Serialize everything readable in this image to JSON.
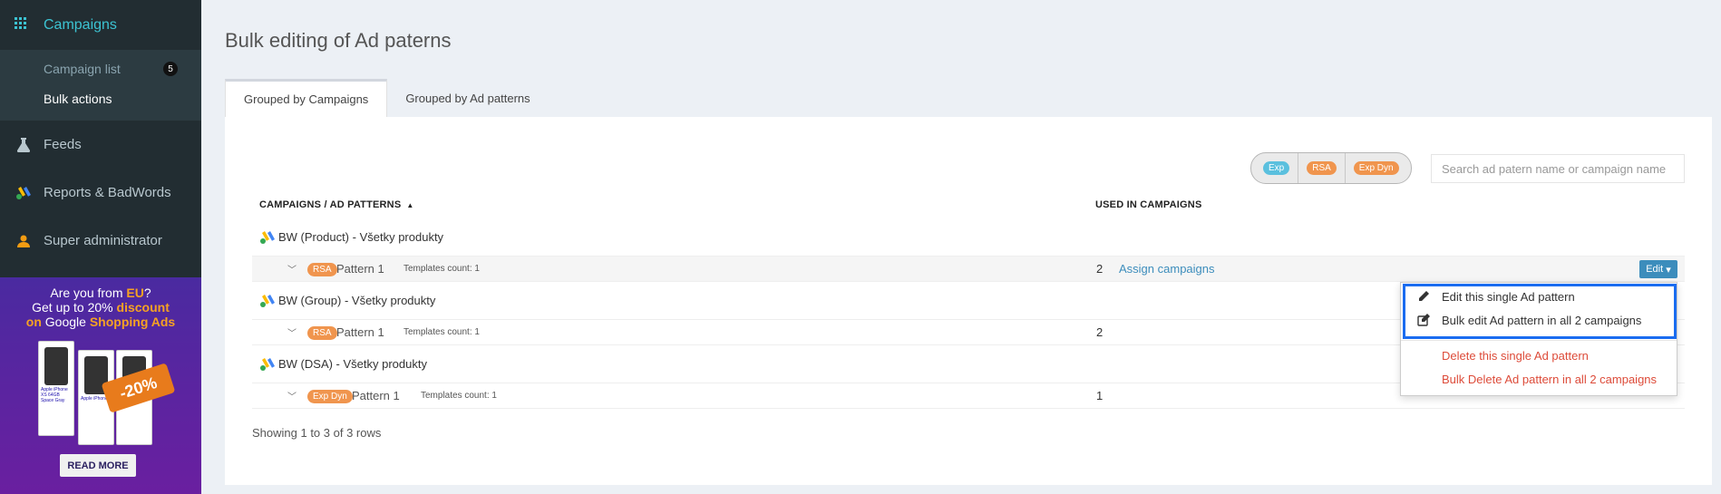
{
  "sidebar": {
    "section_title": "Campaigns",
    "sub_items": [
      {
        "label": "Campaign list",
        "badge": "5"
      },
      {
        "label": "Bulk actions"
      }
    ],
    "items": [
      {
        "label": "Feeds",
        "icon": "flask-icon"
      },
      {
        "label": "Reports & BadWords",
        "icon": "google-ads-icon"
      },
      {
        "label": "Super administrator",
        "icon": "user-icon"
      }
    ]
  },
  "promo": {
    "line1_prefix": "Are you from ",
    "line1_highlight": "EU",
    "line1_suffix": "?",
    "line2_prefix": "Get up to 20% ",
    "line2_highlight": "discount",
    "line3_prefix": "on",
    "line3_middle": " Google ",
    "line3_highlight": "Shopping Ads",
    "stamp": "-20%",
    "button": "READ MORE"
  },
  "page": {
    "title": "Bulk editing of Ad paterns",
    "tabs": [
      "Grouped by Campaigns",
      "Grouped by Ad patterns"
    ]
  },
  "filters": [
    {
      "label": "Exp",
      "color": "#5bc0de"
    },
    {
      "label": "RSA",
      "color": "#f0954e"
    },
    {
      "label": "Exp Dyn",
      "color": "#f0954e"
    }
  ],
  "search": {
    "placeholder": "Search ad patern name or campaign name"
  },
  "table": {
    "col1": "CAMPAIGNS / AD PATTERNS",
    "col2": "USED IN CAMPAIGNS",
    "groups": [
      {
        "campaign": "BW (Product) - Všetky produkty",
        "type": "RSA",
        "pattern": "Pattern 1",
        "templates": "Templates count: 1",
        "used": "2",
        "assign": "Assign campaigns",
        "edit": "Edit"
      },
      {
        "campaign": "BW (Group) - Všetky produkty",
        "type": "RSA",
        "pattern": "Pattern 1",
        "templates": "Templates count: 1",
        "used": "2"
      },
      {
        "campaign": "BW (DSA) - Všetky produkty",
        "type": "Exp Dyn",
        "pattern": "Pattern 1",
        "templates": "Templates count: 1",
        "used": "1"
      }
    ],
    "footer": "Showing 1 to 3 of 3 rows"
  },
  "dropdown": {
    "items": [
      "Edit this single Ad pattern",
      "Bulk edit Ad pattern in all 2 campaigns",
      "Delete this single Ad pattern",
      "Bulk Delete Ad pattern in all 2 campaigns"
    ]
  },
  "colors": {
    "accent": "#3cc3d2",
    "link": "#3c8dbc",
    "danger": "#dd4b39",
    "sidebar": "#222d32",
    "highlight": "#1a6cf0"
  }
}
